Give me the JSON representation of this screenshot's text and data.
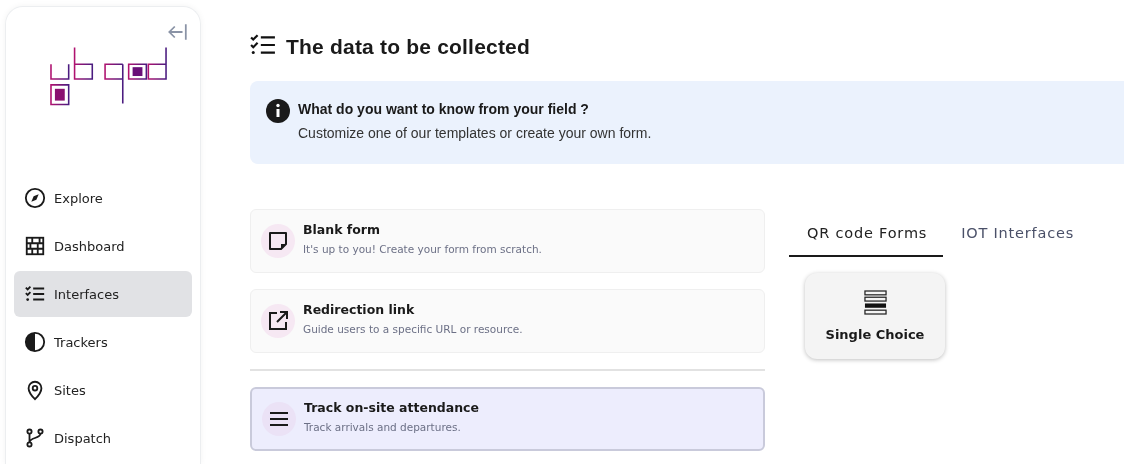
{
  "sidebar": {
    "items": [
      {
        "label": "Explore",
        "selected": false
      },
      {
        "label": "Dashboard",
        "selected": false
      },
      {
        "label": "Interfaces",
        "selected": true
      },
      {
        "label": "Trackers",
        "selected": false
      },
      {
        "label": "Sites",
        "selected": false
      },
      {
        "label": "Dispatch",
        "selected": false
      }
    ]
  },
  "page": {
    "title": "The data to be collected"
  },
  "info": {
    "title": "What do you want to know from your field ?",
    "text": "Customize one of our templates or create your own form."
  },
  "templates": [
    {
      "title": "Blank form",
      "subtitle": "It's up to you! Create your form from scratch.",
      "selected": false,
      "separated": false
    },
    {
      "title": "Redirection link",
      "subtitle": "Guide users to a specific URL or resource.",
      "selected": false,
      "separated": false
    },
    {
      "title": "Track on-site attendance",
      "subtitle": "Track arrivals and departures.",
      "selected": true,
      "separated": true
    }
  ],
  "tabs": [
    {
      "label": "QR code Forms",
      "selected": true
    },
    {
      "label": "IOT Interfaces",
      "selected": false
    }
  ],
  "fields": [
    {
      "label": "Single Choice"
    }
  ]
}
